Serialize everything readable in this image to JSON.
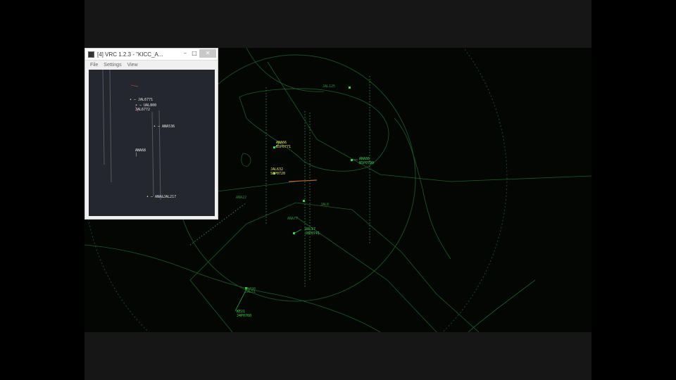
{
  "vrc_window": {
    "title": "[4] VRC 1.2.3 - \"KICC_A...",
    "menu": [
      "File",
      "Settings",
      "View"
    ],
    "minimize_glyph": "–",
    "maximize_glyph": "□",
    "close_glyph": "✕",
    "tags": [
      {
        "text": "• ─ JAL6771"
      },
      {
        "text": "• ─ UAL800\nJAL6772"
      },
      {
        "text": "• ─ ANA536"
      },
      {
        "text": "ANA68\n│"
      },
      {
        "text": "• ─ ANA&JAL217"
      }
    ]
  },
  "radar": {
    "colors": {
      "background": "#030603",
      "video_map": "#1e5b2a",
      "range_ring": "#1c4a24",
      "yellow_tag": "#e8e070",
      "green_tag": "#3ed24c",
      "centerline": "#b0632a"
    },
    "tags": [
      {
        "line1": "ANA66",
        "line2": "B5P0771",
        "color": "yellow"
      },
      {
        "line1": "JAL632",
        "line2": "S8P0720",
        "color": "yellow"
      },
      {
        "line1": "ANA86",
        "line2": "B5P0790",
        "color": "green"
      },
      {
        "line1": "UAL17",
        "line2": "J8P0741",
        "color": "green"
      },
      {
        "line1": "KE21",
        "line2": "J4P0760",
        "color": "green"
      },
      {
        "line1": "ANA22",
        "line2": "",
        "color": "dim"
      },
      {
        "line1": "JAL125",
        "line2": "",
        "color": "dim"
      },
      {
        "line1": "ANA90",
        "line2": "",
        "color": "dim"
      },
      {
        "line1": "JAL51",
        "line2": "",
        "color": "dim"
      },
      {
        "line1": "ANA77",
        "line2": "",
        "color": "dim"
      },
      {
        "line1": "SKY3",
        "line2": "",
        "color": "dim"
      },
      {
        "line1": "JAL8",
        "line2": "",
        "color": "dim"
      }
    ]
  }
}
